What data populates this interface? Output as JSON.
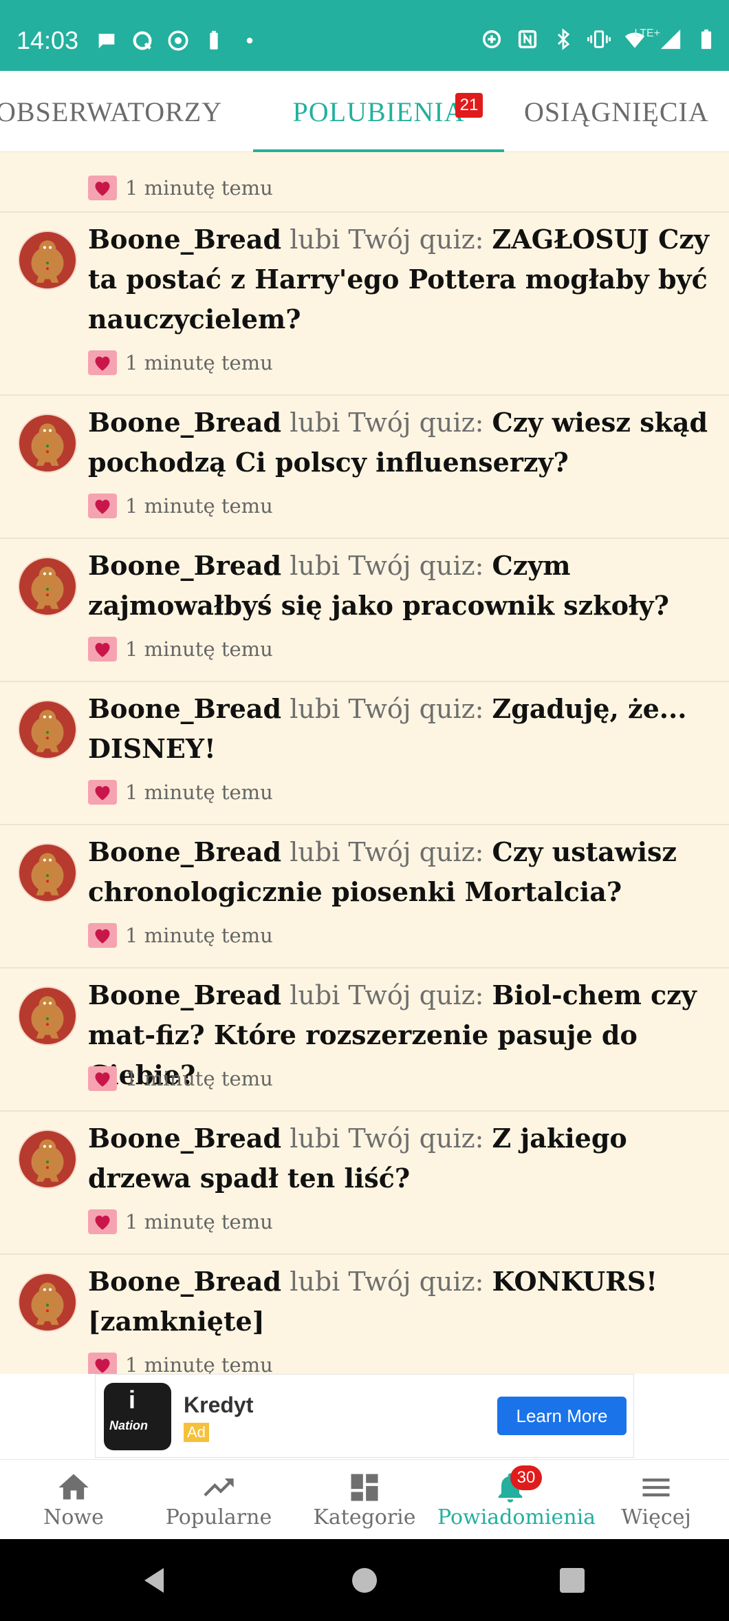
{
  "status_bar": {
    "time": "14:03",
    "left_icons": [
      "chat-icon",
      "q-app-icon",
      "chrome-icon",
      "battery-saver-icon",
      "dot-icon"
    ],
    "right_icons": [
      "data-saver-icon",
      "nfc-icon",
      "bluetooth-icon",
      "vibrate-icon",
      "wifi-icon",
      "signal-icon",
      "battery-icon"
    ],
    "network_label": "LTE+"
  },
  "tabs": [
    {
      "label": "OBSERWATORZY",
      "active": false
    },
    {
      "label": "POLUBIENIA",
      "active": true,
      "badge": "21"
    },
    {
      "label": "OSIĄGNIĘCIA",
      "active": false
    }
  ],
  "notifications": {
    "partial_top": {
      "time": "1 minutę temu"
    },
    "items": [
      {
        "user": "Boone_Bread",
        "action": "lubi Twój quiz:",
        "quiz": "ZAGŁOSUJ Czy ta postać z Harry'ego Pottera mogłaby być nauczycielem?",
        "time": "1 minutę temu"
      },
      {
        "user": "Boone_Bread",
        "action": "lubi Twój quiz:",
        "quiz": "Czy wiesz skąd pochodzą Ci polscy influenserzy?",
        "time": "1 minutę temu"
      },
      {
        "user": "Boone_Bread",
        "action": "lubi Twój quiz:",
        "quiz": "Czym zajmowałbyś się jako pracownik szkoły?",
        "time": "1 minutę temu"
      },
      {
        "user": "Boone_Bread",
        "action": "lubi Twój quiz:",
        "quiz": "Zgaduję, że... DISNEY!",
        "time": "1 minutę temu"
      },
      {
        "user": "Boone_Bread",
        "action": "lubi Twój quiz:",
        "quiz": "Czy ustawisz chronologicznie piosenki Mortalcia?",
        "time": "1 minutę temu"
      },
      {
        "user": "Boone_Bread",
        "action": "lubi Twój quiz:",
        "quiz": "Biol-chem czy mat-fiz? Które rozszerzenie pasuje do Ciebie?",
        "time": "1 minutę temu"
      },
      {
        "user": "Boone_Bread",
        "action": "lubi Twój quiz:",
        "quiz": "Z jakiego drzewa spadł ten liść?",
        "time": "1 minutę temu"
      },
      {
        "user": "Boone_Bread",
        "action": "lubi Twój quiz:",
        "quiz": "KONKURS! [zamknięte]",
        "time": "1 minutę temu"
      }
    ]
  },
  "ad": {
    "logo_letter": "i",
    "logo_brand": "Nation",
    "title": "Kredyt",
    "badge": "Ad",
    "button": "Learn More"
  },
  "bottom_nav": {
    "items": [
      {
        "label": "Nowe",
        "icon": "home-icon"
      },
      {
        "label": "Popularne",
        "icon": "trending-icon"
      },
      {
        "label": "Kategorie",
        "icon": "dashboard-icon"
      },
      {
        "label": "Powiadomienia",
        "icon": "bell-icon",
        "active": true,
        "badge": "30"
      },
      {
        "label": "Więcej",
        "icon": "menu-icon"
      }
    ]
  },
  "colors": {
    "accent": "#23b09e",
    "list_background": "#fdf5e2",
    "badge": "#e01b1b",
    "heart_bg": "#f5a3b0",
    "heart": "#c8164a",
    "ad_button": "#1a73e8"
  }
}
